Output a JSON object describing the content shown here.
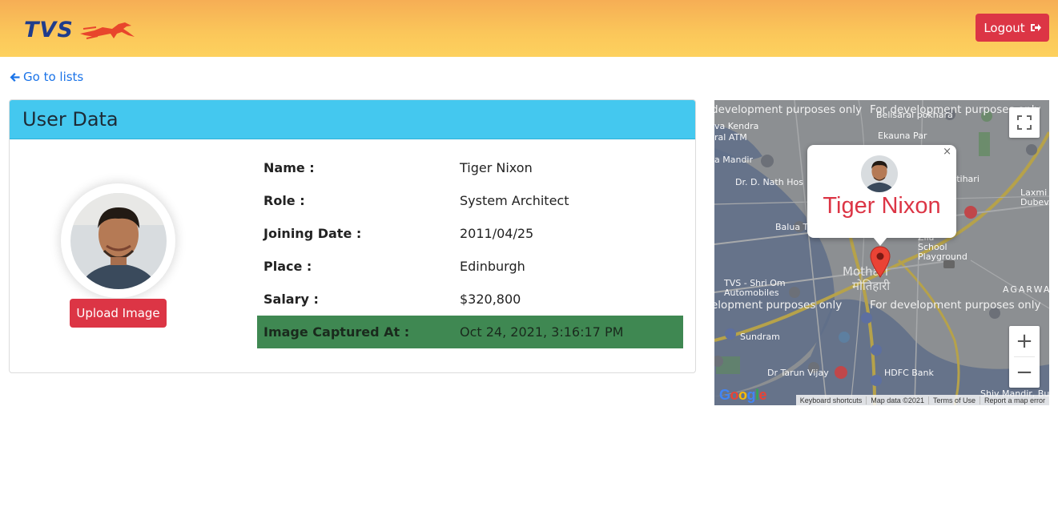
{
  "header": {
    "brand": "TVS",
    "logout_label": "Logout",
    "colors": {
      "brand_blue": "#1f3c8c",
      "accent_red": "#dc3545"
    }
  },
  "nav": {
    "back_label": "Go to lists"
  },
  "card": {
    "title": "User Data",
    "upload_label": "Upload Image",
    "fields": [
      {
        "label": "Name :",
        "value": "Tiger Nixon"
      },
      {
        "label": "Role :",
        "value": "System Architect"
      },
      {
        "label": "Joining Date :",
        "value": "2011/04/25"
      },
      {
        "label": "Place :",
        "value": "Edinburgh"
      },
      {
        "label": "Salary :",
        "value": "$320,800"
      },
      {
        "label": "Image Captured At :",
        "value": "Oct 24, 2021, 3:16:17 PM"
      }
    ]
  },
  "map": {
    "infowindow_name": "Tiger Nixon",
    "close_symbol": "×",
    "dev_watermark": "For development purposes only",
    "dev_watermark_partial": "elopment purposes only",
    "dev_watermark_partial_top": "development purposes only",
    "labels": [
      "Belisarai pokhara",
      "Ekauna Par",
      "Dr. D. Nath Hos",
      "Motihari",
      "Zila School Playground",
      "Mothari",
      "मोतिहारी",
      "TVS - Shri Om Automobiles",
      "Sundram",
      "HDFC Bank",
      "Dr Tarun Vijay",
      "Laxmi Dubev",
      "AGARWA",
      "Shiv Mandir, Bus",
      "Balua T",
      "va Kendra",
      "ral ATM",
      "a Mandir"
    ],
    "footer": [
      "Keyboard shortcuts",
      "Map data ©2021",
      "Terms of Use",
      "Report a map error"
    ],
    "google_logo": "Google",
    "zoom_in": "+",
    "zoom_out": "−"
  }
}
